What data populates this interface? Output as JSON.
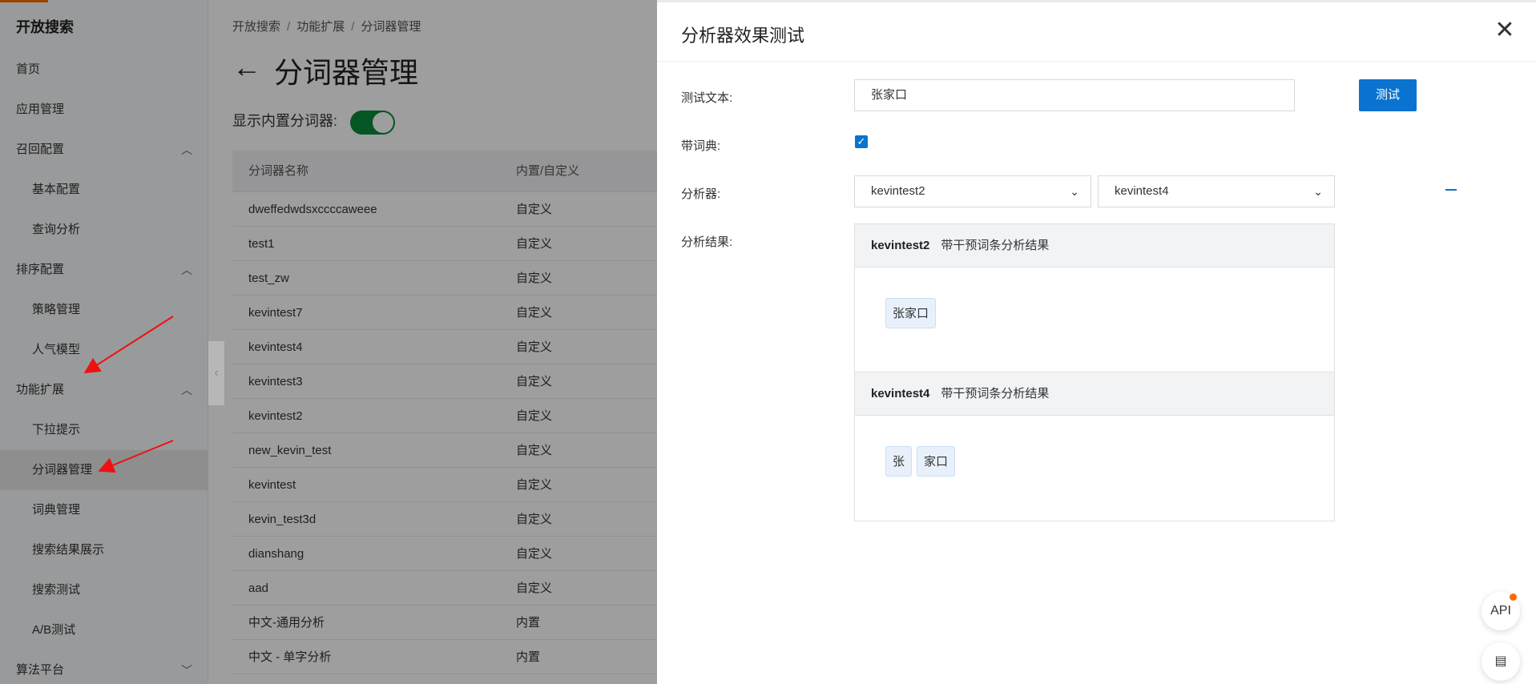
{
  "sidebar": {
    "brand": "开放搜索",
    "items": [
      {
        "label": "首页",
        "level": 1
      },
      {
        "label": "应用管理",
        "level": 1
      },
      {
        "label": "召回配置",
        "level": 1,
        "chevron": "up"
      },
      {
        "label": "基本配置",
        "level": 2
      },
      {
        "label": "查询分析",
        "level": 2
      },
      {
        "label": "排序配置",
        "level": 1,
        "chevron": "up"
      },
      {
        "label": "策略管理",
        "level": 2
      },
      {
        "label": "人气模型",
        "level": 2
      },
      {
        "label": "功能扩展",
        "level": 1,
        "chevron": "up"
      },
      {
        "label": "下拉提示",
        "level": 2
      },
      {
        "label": "分词器管理",
        "level": 2,
        "active": true
      },
      {
        "label": "词典管理",
        "level": 2
      },
      {
        "label": "搜索结果展示",
        "level": 2
      },
      {
        "label": "搜索测试",
        "level": 2
      },
      {
        "label": "A/B测试",
        "level": 2
      },
      {
        "label": "算法平台",
        "level": 1,
        "chevron": "down"
      }
    ]
  },
  "main": {
    "breadcrumb": [
      "开放搜索",
      "功能扩展",
      "分词器管理"
    ],
    "page_title": "分词器管理",
    "toggle_label": "显示内置分词器:",
    "table": {
      "headers": [
        "分词器名称",
        "内置/自定义"
      ],
      "rows": [
        [
          "dweffedwdsxccccaweee",
          "自定义"
        ],
        [
          "test1",
          "自定义"
        ],
        [
          "test_zw",
          "自定义"
        ],
        [
          "kevintest7",
          "自定义"
        ],
        [
          "kevintest4",
          "自定义"
        ],
        [
          "kevintest3",
          "自定义"
        ],
        [
          "kevintest2",
          "自定义"
        ],
        [
          "new_kevin_test",
          "自定义"
        ],
        [
          "kevintest",
          "自定义"
        ],
        [
          "kevin_test3d",
          "自定义"
        ],
        [
          "dianshang",
          "自定义"
        ],
        [
          "aad",
          "自定义"
        ],
        [
          "中文-通用分析",
          "内置"
        ],
        [
          "中文 - 单字分析",
          "内置"
        ]
      ]
    }
  },
  "drawer": {
    "title": "分析器效果测试",
    "labels": {
      "test_text": "测试文本:",
      "with_dict": "带词典:",
      "analyzer": "分析器:",
      "result": "分析结果:"
    },
    "test_text_value": "张家口",
    "test_button": "测试",
    "analyzer_a": "kevintest2",
    "analyzer_b": "kevintest4",
    "results": [
      {
        "name": "kevintest2",
        "desc": "带干预词条分析结果",
        "tokens": [
          "张家口"
        ]
      },
      {
        "name": "kevintest4",
        "desc": "带干预词条分析结果",
        "tokens": [
          "张",
          "家口"
        ]
      }
    ]
  },
  "floating": {
    "api_label": "API"
  },
  "colors": {
    "primary": "#0a73d0",
    "brand": "#ff6a00",
    "toggle_on": "#0a8a3a",
    "arrow": "#ee1111"
  }
}
